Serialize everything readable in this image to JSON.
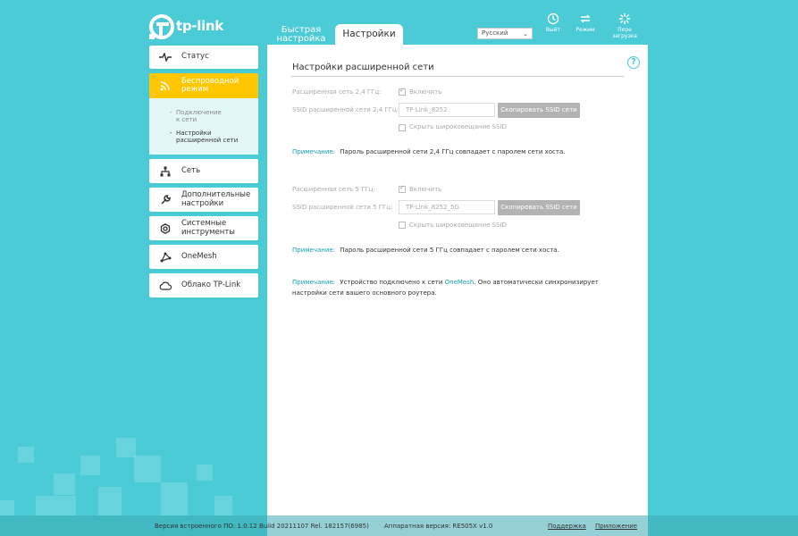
{
  "header": {
    "logo_text": "tp-link",
    "tabs": [
      {
        "label": "Быстрая настройка"
      },
      {
        "label": "Настройки"
      }
    ],
    "language": "Русский",
    "buttons": [
      {
        "label": "Выйт",
        "icon": "logout-icon"
      },
      {
        "label": "Режим",
        "icon": "mode-icon"
      },
      {
        "label": "Перезагрузка",
        "label_line1": "Пере",
        "label_line2": "загрузка",
        "icon": "reboot-icon"
      }
    ]
  },
  "sidebar": {
    "items": [
      {
        "label": "Статус",
        "icon": "pulse-icon"
      },
      {
        "label_line1": "Беспроводной",
        "label_line2": "режим",
        "icon": "wireless-icon",
        "active": true
      },
      {
        "label": "Сеть",
        "icon": "network-icon"
      },
      {
        "label_line1": "Дополнительные",
        "label_line2": "настройки",
        "icon": "wrench-icon"
      },
      {
        "label_line1": "Системные",
        "label_line2": "инструменты",
        "icon": "gear-icon"
      },
      {
        "label": "OneMesh",
        "icon": "onemesh-icon"
      },
      {
        "label": "Облако TP-Link",
        "icon": "cloud-icon"
      }
    ],
    "submenu": [
      {
        "label_line1": "Подключение",
        "label_line2": "к сети"
      },
      {
        "label_line1": "Настройки",
        "label_line2": "расширенной сети",
        "current": true
      }
    ]
  },
  "main": {
    "title": "Настройки расширенной сети",
    "band24": {
      "enable_label": "Расширенная сеть 2,4 ГГц:",
      "enable_checkbox": "Включить",
      "ssid_label": "SSID расширенной сети 2,4 ГГц:",
      "ssid_value": "TP-Link_8252",
      "copy_button": "Скопировать SSID сети",
      "hide_checkbox": "Скрыть широковещание SSID",
      "note_key": "Примечание:",
      "note_text": "Пароль расширенной сети 2,4 ГГц совпадает с паролем сети хоста."
    },
    "band5": {
      "enable_label": "Расширенная сеть 5 ГГц:",
      "enable_checkbox": "Включить",
      "ssid_label": "SSID расширенной сети 5 ГГц:",
      "ssid_value": "TP-Link_8252_5G",
      "copy_button": "Скопировать SSID сети",
      "hide_checkbox": "Скрыть широковещание SSID",
      "note_key": "Примечание:",
      "note_text": "Пароль расширенной сети 5 ГГц совпадает с паролем сети хоста."
    },
    "onemesh_note": {
      "key": "Примечание:",
      "text_before": "Устройство подключено к сети",
      "link": "OneMesh",
      "text_after": ". Оно автоматически синхронизирует настройки сети вашего основного роутера."
    }
  },
  "footer": {
    "firmware": "Версия встроенного ПО: 1.0.12 Build 20211107 Rel. 182157(6985)",
    "hardware": "Аппаратная версия: RE505X v1.0",
    "support": "Поддержка",
    "app": "Приложение"
  },
  "colors": {
    "background": "#4acbd6",
    "active_menu": "#ffc700",
    "accent_link": "#15a0b0",
    "disabled_button": "#b3b3b3"
  }
}
